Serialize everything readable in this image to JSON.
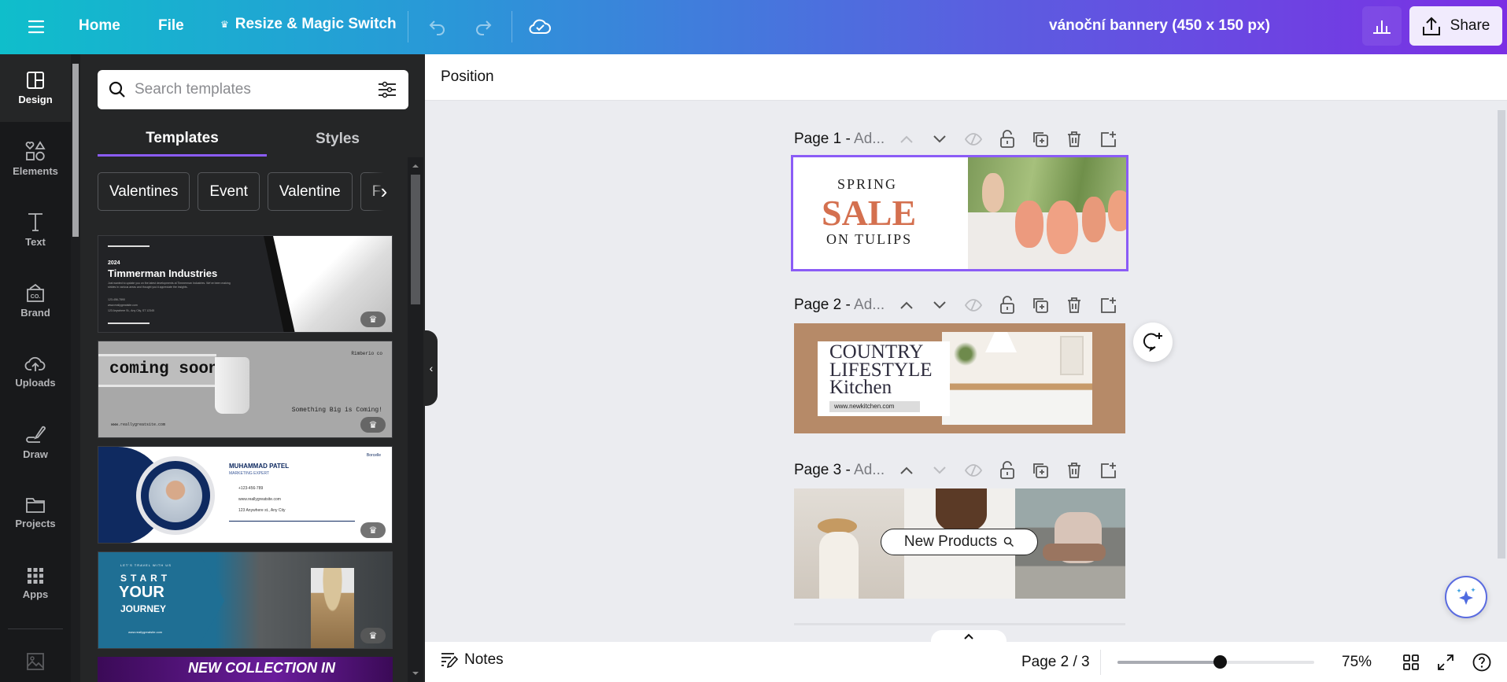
{
  "topbar": {
    "menu_icon": "hamburger-icon",
    "home": "Home",
    "file": "File",
    "resize": "Resize & Magic Switch",
    "title": "vánoční bannery (450 x 150 px)",
    "share": "Share"
  },
  "rail": {
    "items": [
      {
        "label": "Design",
        "icon": "layout-icon",
        "active": true
      },
      {
        "label": "Elements",
        "icon": "shapes-icon"
      },
      {
        "label": "Text",
        "icon": "text-icon"
      },
      {
        "label": "Brand",
        "icon": "brand-icon"
      },
      {
        "label": "Uploads",
        "icon": "cloud-upload-icon"
      },
      {
        "label": "Draw",
        "icon": "draw-icon"
      },
      {
        "label": "Projects",
        "icon": "folder-icon"
      },
      {
        "label": "Apps",
        "icon": "apps-grid-icon"
      }
    ]
  },
  "panel": {
    "search_placeholder": "Search templates",
    "tabs": [
      "Templates",
      "Styles"
    ],
    "chips": [
      "Valentines",
      "Event",
      "Valentine",
      "Fo"
    ],
    "templates": [
      {
        "year": "2024",
        "title": "Timmerman Industries",
        "body": "Just wanted to update you on the latest developments at Timmerman Industries. We've been making strides in various areas and thought you'd appreciate the insights.",
        "phone": "123-456-7890",
        "site": "www.reallygreatsite.com",
        "address": "123 Anywhere St., Any City, ST 12345"
      },
      {
        "headline": "coming soon",
        "brand": "Rimberio co",
        "tagline": "Something Big is Coming!",
        "site": "www.reallygreatsite.com"
      },
      {
        "name": "MUHAMMAD PATEL",
        "role": "MARKETING EXPERT",
        "phone": "+123-456-789",
        "site": "www.reallygreatsite.com",
        "address": "123 Anywhere st., Any City",
        "brand": "Borcelle"
      },
      {
        "kicker": "LET'S TRAVEL WITH US",
        "l1": "START",
        "l2": "YOUR",
        "l3": "JOURNEY",
        "site": "www.reallygreatsite.com"
      },
      {
        "headline": "NEW COLLECTION IN"
      }
    ]
  },
  "toolbar": {
    "position": "Position"
  },
  "pages": [
    {
      "label": "Page 1 -",
      "sub": " Ad...",
      "line1": "SPRING",
      "line2": "SALE",
      "line3": "ON TULIPS"
    },
    {
      "label": "Page 2 -",
      "sub": " Ad...",
      "line1": "COUNTRY",
      "line2": "LIFESTYLE",
      "line3": "Kitchen",
      "site": "www.newkitchen.com"
    },
    {
      "label": "Page 3 -",
      "sub": " Ad...",
      "search_pill": "New Products"
    }
  ],
  "bottombar": {
    "notes": "Notes",
    "page_indicator": "Page 2 / 3",
    "zoom_label": "75%",
    "zoom_value_fraction": 0.52
  },
  "colors": {
    "accent": "#8b5cf6",
    "sale": "#d4704f",
    "kitchen_bg": "#b68a68"
  }
}
